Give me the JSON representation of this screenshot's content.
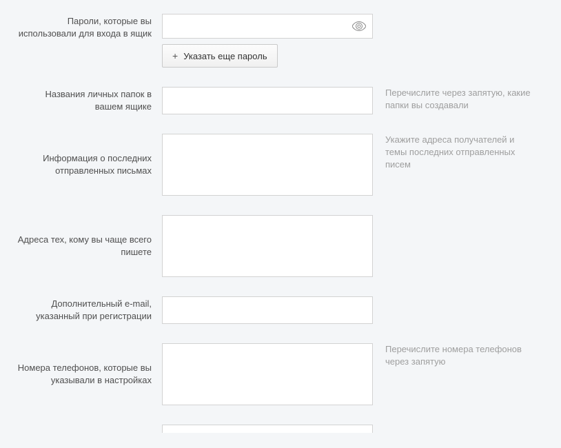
{
  "fields": {
    "passwords": {
      "label": "Пароли, которые вы использовали для входа в ящик",
      "value": "",
      "add_button": "Указать еще пароль"
    },
    "folders": {
      "label": "Названия личных папок в вашем ящике",
      "value": "",
      "hint": "Перечислите через запятую, какие папки вы создавали"
    },
    "last_sent": {
      "label": "Информация о последних отправленных письмах",
      "value": "",
      "hint": "Укажите адреса получателей и темы последних отправленных писем"
    },
    "frequent_addresses": {
      "label": "Адреса тех, кому вы чаще всего пишете",
      "value": ""
    },
    "alt_email": {
      "label": "Дополнительный e-mail, указанный при регистрации",
      "value": ""
    },
    "phones": {
      "label": "Номера телефонов, которые вы указывали в настройках",
      "value": "",
      "hint": "Перечислите номера телефонов через запятую"
    }
  }
}
